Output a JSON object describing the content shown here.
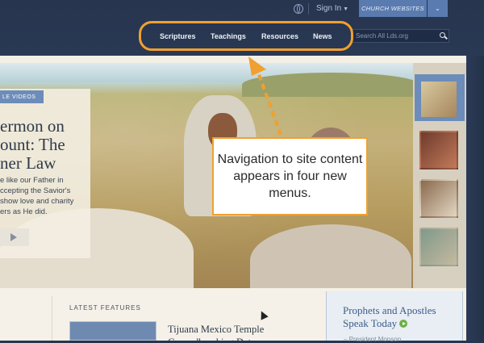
{
  "colors": {
    "page_background": "#2a3956",
    "accent_blue": "#5a7bb0",
    "callout_orange": "#f0a030",
    "green_arrow": "#6db046"
  },
  "topbar": {
    "globe_icon": "globe-icon",
    "sign_in": "Sign In",
    "church_websites": "CHURCH WEBSITES"
  },
  "nav": {
    "items": [
      "Scriptures",
      "Teachings",
      "Resources",
      "News"
    ],
    "search_placeholder": "Search All Lds.org",
    "search_icon": "search-icon"
  },
  "hero": {
    "badge": "LE VIDEOS",
    "title_lines": [
      "ermon on",
      "ount: The",
      "ner Law"
    ],
    "desc_lines": [
      "e like our Father in",
      "ccepting the Savior's",
      "show love and charity",
      "ers as He did."
    ],
    "play_icon": "play-icon"
  },
  "callout": {
    "text": "Navigation to site content appears in four new menus."
  },
  "latest": {
    "heading": "LATEST FEATURES",
    "feature_title": "Tijuana Mexico Temple Groundbreaking Date"
  },
  "prophets": {
    "title": "Prophets and Apostles Speak Today",
    "sub": "– President Monson"
  }
}
